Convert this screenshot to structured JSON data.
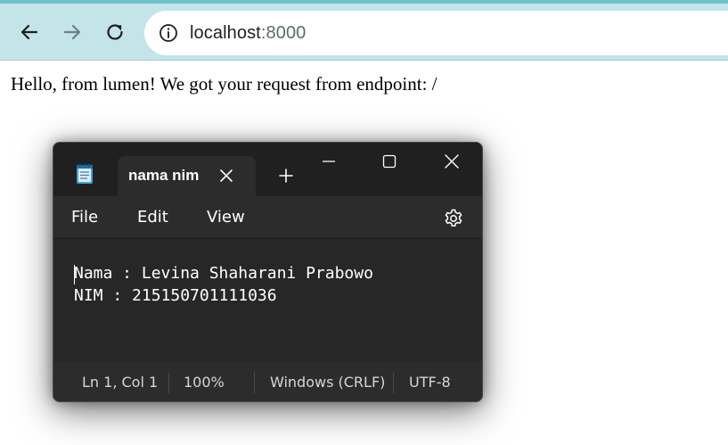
{
  "browser": {
    "url_host": "localhost",
    "url_port": ":8000",
    "icons": {
      "back": "arrow-left-icon",
      "forward": "arrow-right-icon",
      "reload": "reload-icon",
      "site_info": "info-icon"
    }
  },
  "page": {
    "message": "Hello, from lumen! We got your request from endpoint: /"
  },
  "notepad": {
    "tab_title": "nama nim",
    "menu": {
      "file": "File",
      "edit": "Edit",
      "view": "View"
    },
    "editor_lines": [
      "Nama : Levina Shaharani Prabowo",
      "NIM : 215150701111036"
    ],
    "status": {
      "position": "Ln 1, Col 1",
      "zoom": "100%",
      "line_ending": "Windows (CRLF)",
      "encoding": "UTF-8"
    },
    "colors": {
      "titlebar": "#202020",
      "surface": "#272727",
      "text": "#ffffff"
    }
  }
}
